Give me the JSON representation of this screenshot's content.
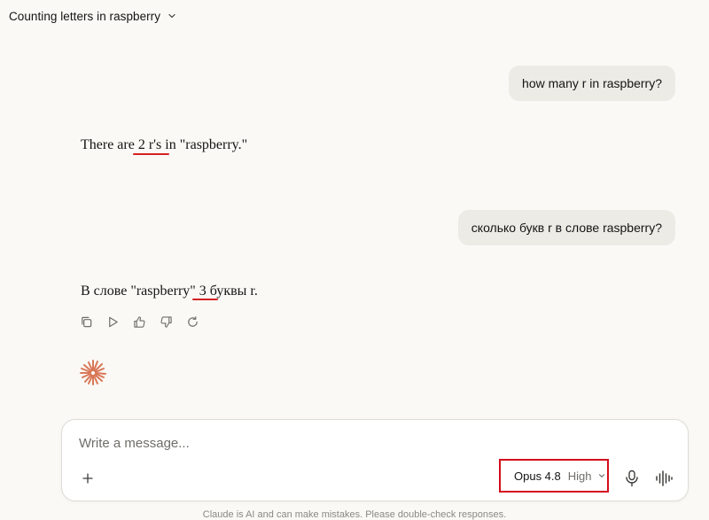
{
  "header": {
    "title": "Counting letters in raspberry"
  },
  "conversation": {
    "user_message_1": "how many r in raspberry?",
    "assistant_message_1": {
      "before": "There are",
      "highlight": "2 r's in",
      "after": "\"raspberry.\""
    },
    "user_message_2": "сколько букв r в слове raspberry?",
    "assistant_message_2": {
      "before": "В слове \"raspberry\"",
      "highlight": "3",
      "after": "буквы r."
    }
  },
  "actions": [
    "copy-icon",
    "play-icon",
    "thumbs-up-icon",
    "thumbs-down-icon",
    "retry-icon"
  ],
  "composer": {
    "placeholder": "Write a message...",
    "model_name": "Opus 4.8",
    "effort": "High"
  },
  "footer": {
    "disclaimer": "Claude is AI and can make mistakes. Please double-check responses."
  },
  "colors": {
    "background": "#faf9f5",
    "user_bubble": "#ecebe6",
    "annotation_red": "#d42222",
    "spark": "#d97757"
  }
}
